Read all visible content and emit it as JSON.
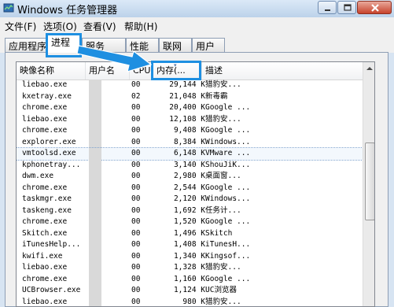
{
  "window": {
    "title": "Windows 任务管理器"
  },
  "menu": {
    "items": [
      "文件(F)",
      "选项(O)",
      "查看(V)",
      "帮助(H)"
    ]
  },
  "tabs": [
    {
      "label": "应用程序"
    },
    {
      "label": "进程"
    },
    {
      "label": "服务"
    },
    {
      "label": "性能"
    },
    {
      "label": "联网"
    },
    {
      "label": "用户"
    }
  ],
  "columns": {
    "name": "映像名称",
    "user": "用户名",
    "cpu": "CPU",
    "memory": "内存(...",
    "description": "描述"
  },
  "processes": [
    {
      "name": "liebao.exe",
      "cpu": "00",
      "memory": "29,144 K",
      "description": "猎豹安..."
    },
    {
      "name": "kxetray.exe",
      "cpu": "02",
      "memory": "21,048 K",
      "description": "新毒霸"
    },
    {
      "name": "chrome.exe",
      "cpu": "00",
      "memory": "20,400 K",
      "description": "Google ..."
    },
    {
      "name": "liebao.exe",
      "cpu": "00",
      "memory": "12,108 K",
      "description": "猎豹安..."
    },
    {
      "name": "chrome.exe",
      "cpu": "00",
      "memory": "9,408 K",
      "description": "Google ..."
    },
    {
      "name": "explorer.exe",
      "cpu": "00",
      "memory": "8,384 K",
      "description": "Windows..."
    },
    {
      "name": "vmtoolsd.exe",
      "cpu": "00",
      "memory": "6,148 K",
      "description": "VMware ..."
    },
    {
      "name": "kphonetray...",
      "cpu": "00",
      "memory": "3,140 K",
      "description": "ShouJiK..."
    },
    {
      "name": "dwm.exe",
      "cpu": "00",
      "memory": "2,980 K",
      "description": "桌面窗..."
    },
    {
      "name": "chrome.exe",
      "cpu": "00",
      "memory": "2,544 K",
      "description": "Google ..."
    },
    {
      "name": "taskmgr.exe",
      "cpu": "00",
      "memory": "2,120 K",
      "description": "Windows..."
    },
    {
      "name": "taskeng.exe",
      "cpu": "00",
      "memory": "1,692 K",
      "description": "任务计..."
    },
    {
      "name": "chrome.exe",
      "cpu": "00",
      "memory": "1,520 K",
      "description": "Google ..."
    },
    {
      "name": "Skitch.exe",
      "cpu": "00",
      "memory": "1,496 K",
      "description": "Skitch"
    },
    {
      "name": "iTunesHelp...",
      "cpu": "00",
      "memory": "1,408 K",
      "description": "iTunesH..."
    },
    {
      "name": "kwifi.exe",
      "cpu": "00",
      "memory": "1,340 K",
      "description": "Kingsof..."
    },
    {
      "name": "liebao.exe",
      "cpu": "00",
      "memory": "1,328 K",
      "description": "猎豹安..."
    },
    {
      "name": "chrome.exe",
      "cpu": "00",
      "memory": "1,160 K",
      "description": "Google ..."
    },
    {
      "name": "UCBrowser.exe",
      "cpu": "00",
      "memory": "1,124 K",
      "description": "UC浏览器"
    },
    {
      "name": "liebao.exe",
      "cpu": "00",
      "memory": "980 K",
      "description": "猎豹安..."
    }
  ],
  "selected_row": 0,
  "highlighted_row": 6,
  "colors": {
    "annotation": "#1e8fe1",
    "close_button": "#c7432c"
  }
}
